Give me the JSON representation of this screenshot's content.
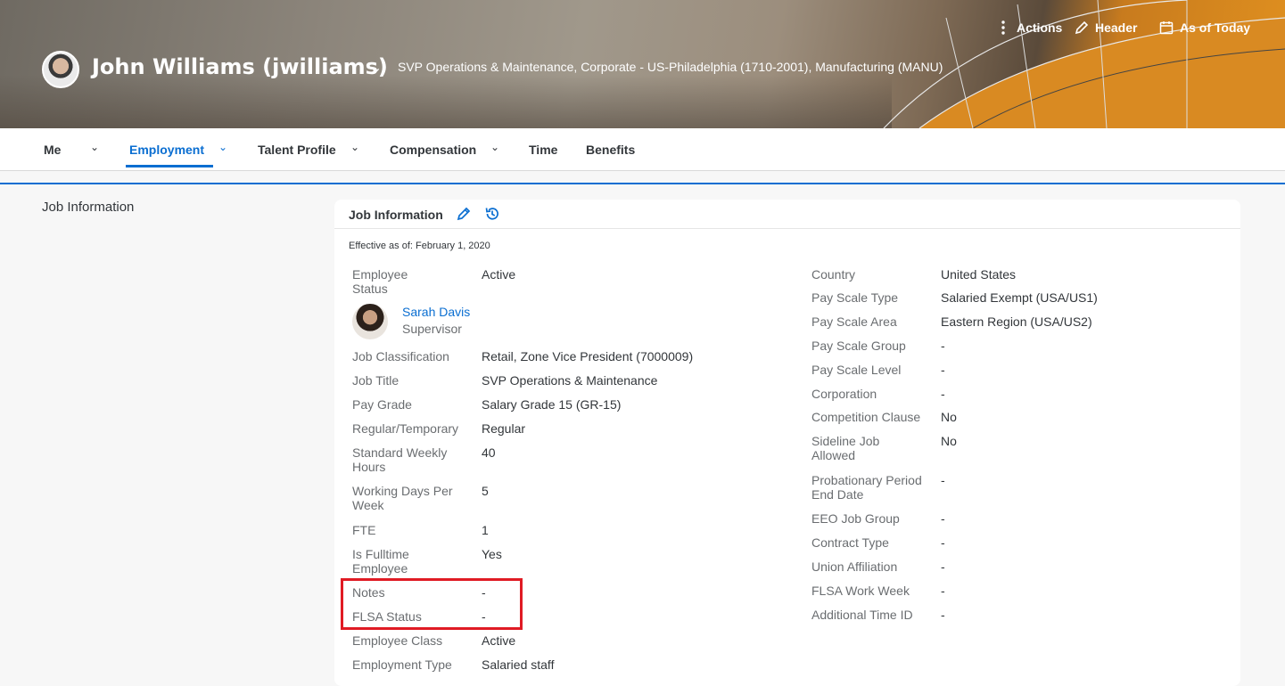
{
  "header": {
    "name": "John Williams (jwilliams)",
    "subtitle": "SVP Operations & Maintenance, Corporate - US-Philadelphia (1710-2001), Manufacturing (MANU)",
    "actions_label": "Actions",
    "header_label": "Header",
    "asof_label": "As of Today"
  },
  "nav": {
    "me": "Me",
    "employment": "Employment",
    "talent": "Talent Profile",
    "compensation": "Compensation",
    "time": "Time",
    "benefits": "Benefits"
  },
  "side_title": "Job Information",
  "card": {
    "title": "Job Information",
    "effective": "Effective as of: February 1, 2020",
    "supervisor": {
      "name": "Sarah Davis",
      "role": "Supervisor"
    },
    "left": [
      {
        "label": "Employee Status",
        "value": "Active"
      },
      {
        "label": "Job Classification",
        "value": "Retail, Zone Vice President (7000009)"
      },
      {
        "label": "Job Title",
        "value": "SVP Operations & Maintenance"
      },
      {
        "label": "Pay Grade",
        "value": "Salary Grade 15 (GR-15)"
      },
      {
        "label": "Regular/Temporary",
        "value": "Regular"
      },
      {
        "label": "Standard Weekly Hours",
        "value": "40"
      },
      {
        "label": "Working Days Per Week",
        "value": "5"
      },
      {
        "label": "FTE",
        "value": "1"
      },
      {
        "label": "Is Fulltime Employee",
        "value": "Yes"
      },
      {
        "label": "Notes",
        "value": "-"
      },
      {
        "label": "FLSA Status",
        "value": "-"
      },
      {
        "label": "Employee Class",
        "value": "Active"
      },
      {
        "label": "Employment Type",
        "value": "Salaried staff"
      }
    ],
    "right": [
      {
        "label": "Country",
        "value": "United States"
      },
      {
        "label": "Pay Scale Type",
        "value": "Salaried Exempt (USA/US1)"
      },
      {
        "label": "Pay Scale Area",
        "value": "Eastern Region (USA/US2)"
      },
      {
        "label": "Pay Scale Group",
        "value": "-"
      },
      {
        "label": "Pay Scale Level",
        "value": "-"
      },
      {
        "label": "Corporation",
        "value": "-"
      },
      {
        "label": "Competition Clause",
        "value": "No"
      },
      {
        "label": "Sideline Job Allowed",
        "value": "No"
      },
      {
        "label": "Probationary Period End Date",
        "value": "-"
      },
      {
        "label": "EEO Job Group",
        "value": "-"
      },
      {
        "label": "Contract Type",
        "value": "-"
      },
      {
        "label": "Union Affiliation",
        "value": "-"
      },
      {
        "label": "FLSA Work Week",
        "value": "-"
      },
      {
        "label": "Additional Time ID",
        "value": "-"
      }
    ]
  }
}
